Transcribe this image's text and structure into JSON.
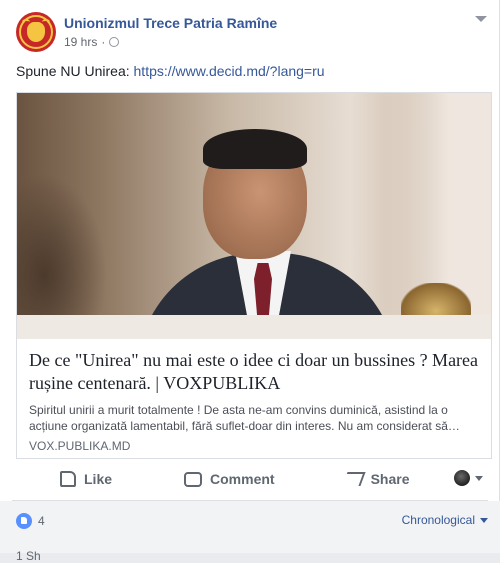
{
  "post": {
    "page_name": "Unionizmul Trece Patria Ramîne",
    "time": "19 hrs",
    "separator": "·",
    "text": "Spune NU Unirea:",
    "link_text": "https://www.decid.md/?lang=ru"
  },
  "attachment": {
    "title": "De ce \"Unirea\" nu mai este o idee ci doar un bussines ? Marea rușine centenară. | VOXPUBLIKA",
    "description": "Spiritul unirii a murit totalmente ! De asta ne-am convins duminică, asistind la o acțiune organizată lamentabil, fără suflet-doar din interes. Nu am considerat să…",
    "domain": "VOX.PUBLIKA.MD"
  },
  "actions": {
    "like": "Like",
    "comment": "Comment",
    "share": "Share"
  },
  "footer": {
    "reaction_count": "4",
    "sort_label": "Chronological",
    "shares_peek": "1 Sh"
  },
  "colors": {
    "link": "#365899",
    "like_blue": "#5890ff"
  }
}
